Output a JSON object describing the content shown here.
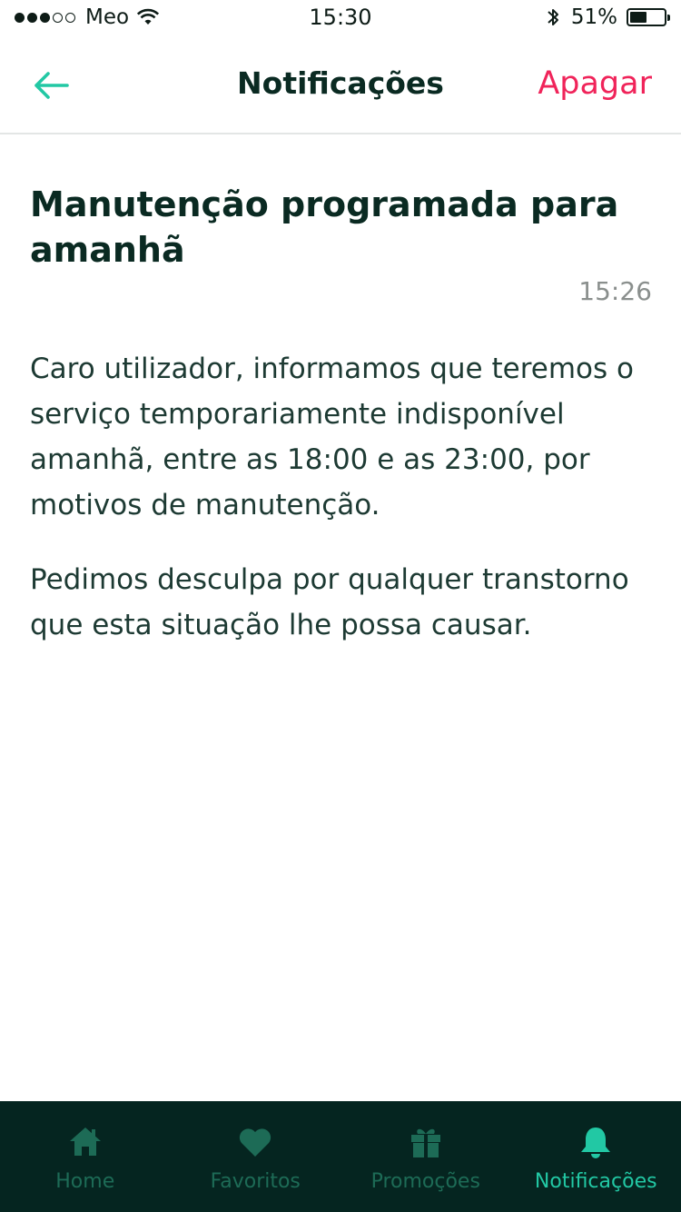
{
  "status_bar": {
    "carrier": "Meo",
    "time": "15:30",
    "battery_percent": "51%",
    "battery_level": 0.51,
    "signal_bars_filled": 3,
    "signal_bars_total": 5
  },
  "nav": {
    "title": "Notificações",
    "back_icon": "arrow-left-icon",
    "delete_label": "Apagar"
  },
  "notification": {
    "title": "Manutenção programada para amanhã",
    "time": "15:26",
    "paragraphs": [
      "Caro utilizador, informamos que teremos o serviço temporariamente indisponível amanhã, entre as 18:00 e as 23:00, por motivos de manutenção.",
      "Pedimos desculpa por qualquer transtorno que esta situação lhe possa causar."
    ]
  },
  "tab_bar": {
    "items": [
      {
        "label": "Home",
        "icon": "home-icon",
        "active": false
      },
      {
        "label": "Favoritos",
        "icon": "heart-icon",
        "active": false
      },
      {
        "label": "Promoções",
        "icon": "gift-icon",
        "active": false
      },
      {
        "label": "Notificações",
        "icon": "bell-icon",
        "active": true
      }
    ]
  },
  "colors": {
    "accent": "#22c8a4",
    "delete": "#f0245a",
    "tab_bar_bg": "#052520",
    "tab_inactive": "#1d6b56",
    "title_text": "#0a2a22"
  }
}
